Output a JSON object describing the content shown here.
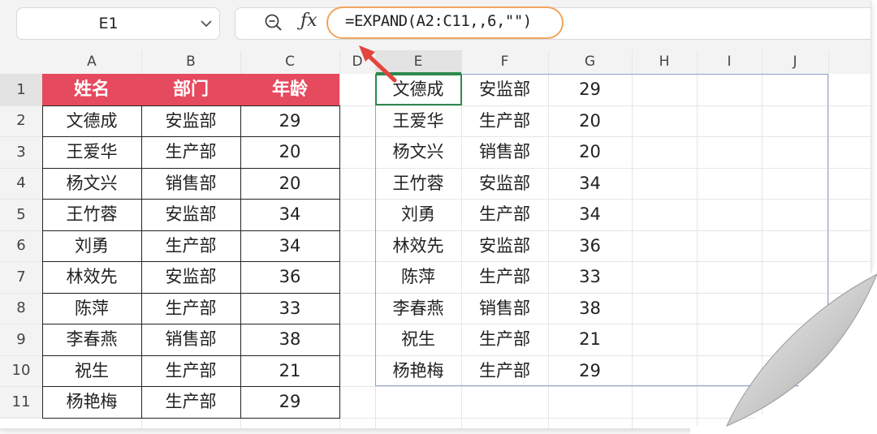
{
  "toolbar": {
    "name_box": "E1",
    "formula": "=EXPAND(A2:C11,,6,\"\")"
  },
  "columns": [
    "A",
    "B",
    "C",
    "D",
    "E",
    "F",
    "G",
    "H",
    "I",
    "J"
  ],
  "rows": [
    "1",
    "2",
    "3",
    "4",
    "5",
    "6",
    "7",
    "8",
    "9",
    "10",
    "11"
  ],
  "source_table": {
    "headers": [
      "姓名",
      "部门",
      "年龄"
    ],
    "rows": [
      [
        "文德成",
        "安监部",
        "29"
      ],
      [
        "王爱华",
        "生产部",
        "20"
      ],
      [
        "杨文兴",
        "销售部",
        "20"
      ],
      [
        "王竹蓉",
        "安监部",
        "34"
      ],
      [
        "刘勇",
        "生产部",
        "34"
      ],
      [
        "林效先",
        "安监部",
        "36"
      ],
      [
        "陈萍",
        "生产部",
        "33"
      ],
      [
        "李春燕",
        "销售部",
        "38"
      ],
      [
        "祝生",
        "生产部",
        "21"
      ],
      [
        "杨艳梅",
        "生产部",
        "29"
      ]
    ]
  },
  "result_table": {
    "rows": [
      [
        "文德成",
        "安监部",
        "29"
      ],
      [
        "王爱华",
        "生产部",
        "20"
      ],
      [
        "杨文兴",
        "销售部",
        "20"
      ],
      [
        "王竹蓉",
        "安监部",
        "34"
      ],
      [
        "刘勇",
        "生产部",
        "34"
      ],
      [
        "林效先",
        "安监部",
        "36"
      ],
      [
        "陈萍",
        "生产部",
        "33"
      ],
      [
        "李春燕",
        "销售部",
        "38"
      ],
      [
        "祝生",
        "生产部",
        "21"
      ],
      [
        "杨艳梅",
        "生产部",
        "29"
      ]
    ]
  },
  "colors": {
    "header_fill": "#e64a5e",
    "selection": "#2d8a4e",
    "highlight_outline": "#f0a45c",
    "arrow": "#e2453c"
  },
  "icons": {
    "zoom": "zoom-out-icon",
    "function": "fx-icon",
    "dropdown": "chevron-down-icon"
  }
}
